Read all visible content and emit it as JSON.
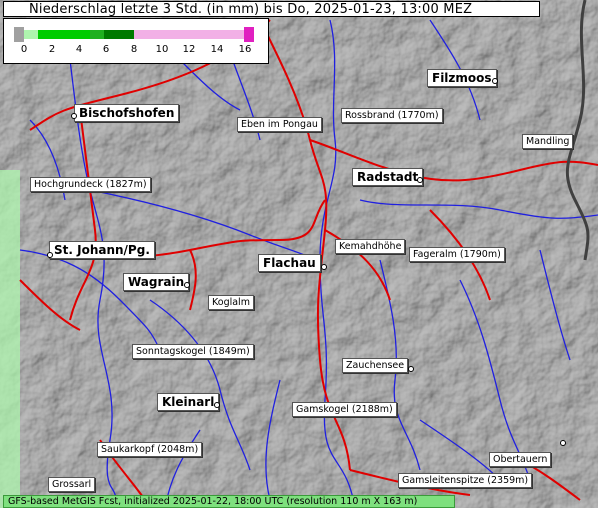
{
  "title": "Niederschlag letzte 3 Std. (in mm) bis Do, 2025-01-23, 13:00 MEZ",
  "legend": {
    "ticks": [
      "0",
      "2",
      "4",
      "6",
      "8",
      "10",
      "12",
      "14",
      "16"
    ],
    "colors": {
      "zero": "#a0a0a0",
      "light_green": "#aef5ae",
      "green": "#00cc00",
      "dark_green": "#007a00",
      "pink": "#f2b0e6",
      "magenta": "#e020c0"
    }
  },
  "places": [
    {
      "name": "Filzmoos",
      "major": true
    },
    {
      "name": "Bischofshofen",
      "major": true
    },
    {
      "name": "Eben im Pongau",
      "major": false
    },
    {
      "name": "Rossbrand (1770m)",
      "major": false
    },
    {
      "name": "Mandling",
      "major": false
    },
    {
      "name": "Radstadt",
      "major": true
    },
    {
      "name": "Hochgrundeck (1827m)",
      "major": false
    },
    {
      "name": "Kemahdhöhe",
      "major": false
    },
    {
      "name": "St. Johann/Pg.",
      "major": true
    },
    {
      "name": "Fageralm (1790m)",
      "major": false
    },
    {
      "name": "Flachau",
      "major": true
    },
    {
      "name": "Wagrain",
      "major": true
    },
    {
      "name": "Koglalm",
      "major": false
    },
    {
      "name": "Sonntagskogel (1849m)",
      "major": false
    },
    {
      "name": "Zauchensee",
      "major": false
    },
    {
      "name": "Kleinarl",
      "major": true
    },
    {
      "name": "Gamskogel (2188m)",
      "major": false
    },
    {
      "name": "Saukarkopf (2048m)",
      "major": false
    },
    {
      "name": "Obertauern",
      "major": false
    },
    {
      "name": "Gamsleitenspitze (2359m)",
      "major": false
    },
    {
      "name": "Grossarl",
      "major": false
    }
  ],
  "footer": "GFS-based MetGIS Fcst, initialized 2025-01-22, 18:00 UTC  (resolution 110 m X 163 m)",
  "colors": {
    "roads": "#e00000",
    "rivers": "#2020e0",
    "border": "#404040",
    "terrain": "#9a9a9a"
  }
}
